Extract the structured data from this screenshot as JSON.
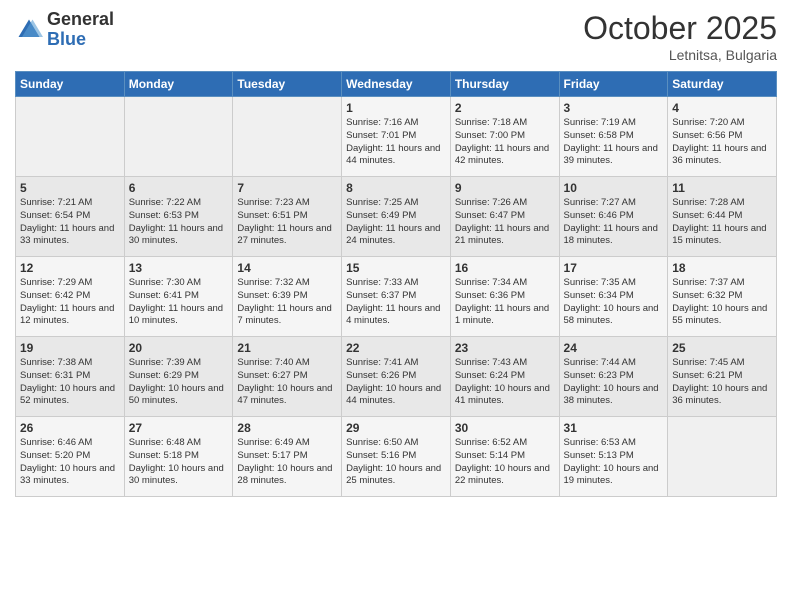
{
  "logo": {
    "general": "General",
    "blue": "Blue"
  },
  "title": {
    "month": "October 2025",
    "location": "Letnitsa, Bulgaria"
  },
  "headers": [
    "Sunday",
    "Monday",
    "Tuesday",
    "Wednesday",
    "Thursday",
    "Friday",
    "Saturday"
  ],
  "rows": [
    [
      {
        "day": "",
        "sunrise": "",
        "sunset": "",
        "daylight": ""
      },
      {
        "day": "",
        "sunrise": "",
        "sunset": "",
        "daylight": ""
      },
      {
        "day": "",
        "sunrise": "",
        "sunset": "",
        "daylight": ""
      },
      {
        "day": "1",
        "sunrise": "Sunrise: 7:16 AM",
        "sunset": "Sunset: 7:01 PM",
        "daylight": "Daylight: 11 hours and 44 minutes."
      },
      {
        "day": "2",
        "sunrise": "Sunrise: 7:18 AM",
        "sunset": "Sunset: 7:00 PM",
        "daylight": "Daylight: 11 hours and 42 minutes."
      },
      {
        "day": "3",
        "sunrise": "Sunrise: 7:19 AM",
        "sunset": "Sunset: 6:58 PM",
        "daylight": "Daylight: 11 hours and 39 minutes."
      },
      {
        "day": "4",
        "sunrise": "Sunrise: 7:20 AM",
        "sunset": "Sunset: 6:56 PM",
        "daylight": "Daylight: 11 hours and 36 minutes."
      }
    ],
    [
      {
        "day": "5",
        "sunrise": "Sunrise: 7:21 AM",
        "sunset": "Sunset: 6:54 PM",
        "daylight": "Daylight: 11 hours and 33 minutes."
      },
      {
        "day": "6",
        "sunrise": "Sunrise: 7:22 AM",
        "sunset": "Sunset: 6:53 PM",
        "daylight": "Daylight: 11 hours and 30 minutes."
      },
      {
        "day": "7",
        "sunrise": "Sunrise: 7:23 AM",
        "sunset": "Sunset: 6:51 PM",
        "daylight": "Daylight: 11 hours and 27 minutes."
      },
      {
        "day": "8",
        "sunrise": "Sunrise: 7:25 AM",
        "sunset": "Sunset: 6:49 PM",
        "daylight": "Daylight: 11 hours and 24 minutes."
      },
      {
        "day": "9",
        "sunrise": "Sunrise: 7:26 AM",
        "sunset": "Sunset: 6:47 PM",
        "daylight": "Daylight: 11 hours and 21 minutes."
      },
      {
        "day": "10",
        "sunrise": "Sunrise: 7:27 AM",
        "sunset": "Sunset: 6:46 PM",
        "daylight": "Daylight: 11 hours and 18 minutes."
      },
      {
        "day": "11",
        "sunrise": "Sunrise: 7:28 AM",
        "sunset": "Sunset: 6:44 PM",
        "daylight": "Daylight: 11 hours and 15 minutes."
      }
    ],
    [
      {
        "day": "12",
        "sunrise": "Sunrise: 7:29 AM",
        "sunset": "Sunset: 6:42 PM",
        "daylight": "Daylight: 11 hours and 12 minutes."
      },
      {
        "day": "13",
        "sunrise": "Sunrise: 7:30 AM",
        "sunset": "Sunset: 6:41 PM",
        "daylight": "Daylight: 11 hours and 10 minutes."
      },
      {
        "day": "14",
        "sunrise": "Sunrise: 7:32 AM",
        "sunset": "Sunset: 6:39 PM",
        "daylight": "Daylight: 11 hours and 7 minutes."
      },
      {
        "day": "15",
        "sunrise": "Sunrise: 7:33 AM",
        "sunset": "Sunset: 6:37 PM",
        "daylight": "Daylight: 11 hours and 4 minutes."
      },
      {
        "day": "16",
        "sunrise": "Sunrise: 7:34 AM",
        "sunset": "Sunset: 6:36 PM",
        "daylight": "Daylight: 11 hours and 1 minute."
      },
      {
        "day": "17",
        "sunrise": "Sunrise: 7:35 AM",
        "sunset": "Sunset: 6:34 PM",
        "daylight": "Daylight: 10 hours and 58 minutes."
      },
      {
        "day": "18",
        "sunrise": "Sunrise: 7:37 AM",
        "sunset": "Sunset: 6:32 PM",
        "daylight": "Daylight: 10 hours and 55 minutes."
      }
    ],
    [
      {
        "day": "19",
        "sunrise": "Sunrise: 7:38 AM",
        "sunset": "Sunset: 6:31 PM",
        "daylight": "Daylight: 10 hours and 52 minutes."
      },
      {
        "day": "20",
        "sunrise": "Sunrise: 7:39 AM",
        "sunset": "Sunset: 6:29 PM",
        "daylight": "Daylight: 10 hours and 50 minutes."
      },
      {
        "day": "21",
        "sunrise": "Sunrise: 7:40 AM",
        "sunset": "Sunset: 6:27 PM",
        "daylight": "Daylight: 10 hours and 47 minutes."
      },
      {
        "day": "22",
        "sunrise": "Sunrise: 7:41 AM",
        "sunset": "Sunset: 6:26 PM",
        "daylight": "Daylight: 10 hours and 44 minutes."
      },
      {
        "day": "23",
        "sunrise": "Sunrise: 7:43 AM",
        "sunset": "Sunset: 6:24 PM",
        "daylight": "Daylight: 10 hours and 41 minutes."
      },
      {
        "day": "24",
        "sunrise": "Sunrise: 7:44 AM",
        "sunset": "Sunset: 6:23 PM",
        "daylight": "Daylight: 10 hours and 38 minutes."
      },
      {
        "day": "25",
        "sunrise": "Sunrise: 7:45 AM",
        "sunset": "Sunset: 6:21 PM",
        "daylight": "Daylight: 10 hours and 36 minutes."
      }
    ],
    [
      {
        "day": "26",
        "sunrise": "Sunrise: 6:46 AM",
        "sunset": "Sunset: 5:20 PM",
        "daylight": "Daylight: 10 hours and 33 minutes."
      },
      {
        "day": "27",
        "sunrise": "Sunrise: 6:48 AM",
        "sunset": "Sunset: 5:18 PM",
        "daylight": "Daylight: 10 hours and 30 minutes."
      },
      {
        "day": "28",
        "sunrise": "Sunrise: 6:49 AM",
        "sunset": "Sunset: 5:17 PM",
        "daylight": "Daylight: 10 hours and 28 minutes."
      },
      {
        "day": "29",
        "sunrise": "Sunrise: 6:50 AM",
        "sunset": "Sunset: 5:16 PM",
        "daylight": "Daylight: 10 hours and 25 minutes."
      },
      {
        "day": "30",
        "sunrise": "Sunrise: 6:52 AM",
        "sunset": "Sunset: 5:14 PM",
        "daylight": "Daylight: 10 hours and 22 minutes."
      },
      {
        "day": "31",
        "sunrise": "Sunrise: 6:53 AM",
        "sunset": "Sunset: 5:13 PM",
        "daylight": "Daylight: 10 hours and 19 minutes."
      },
      {
        "day": "",
        "sunrise": "",
        "sunset": "",
        "daylight": ""
      }
    ]
  ]
}
